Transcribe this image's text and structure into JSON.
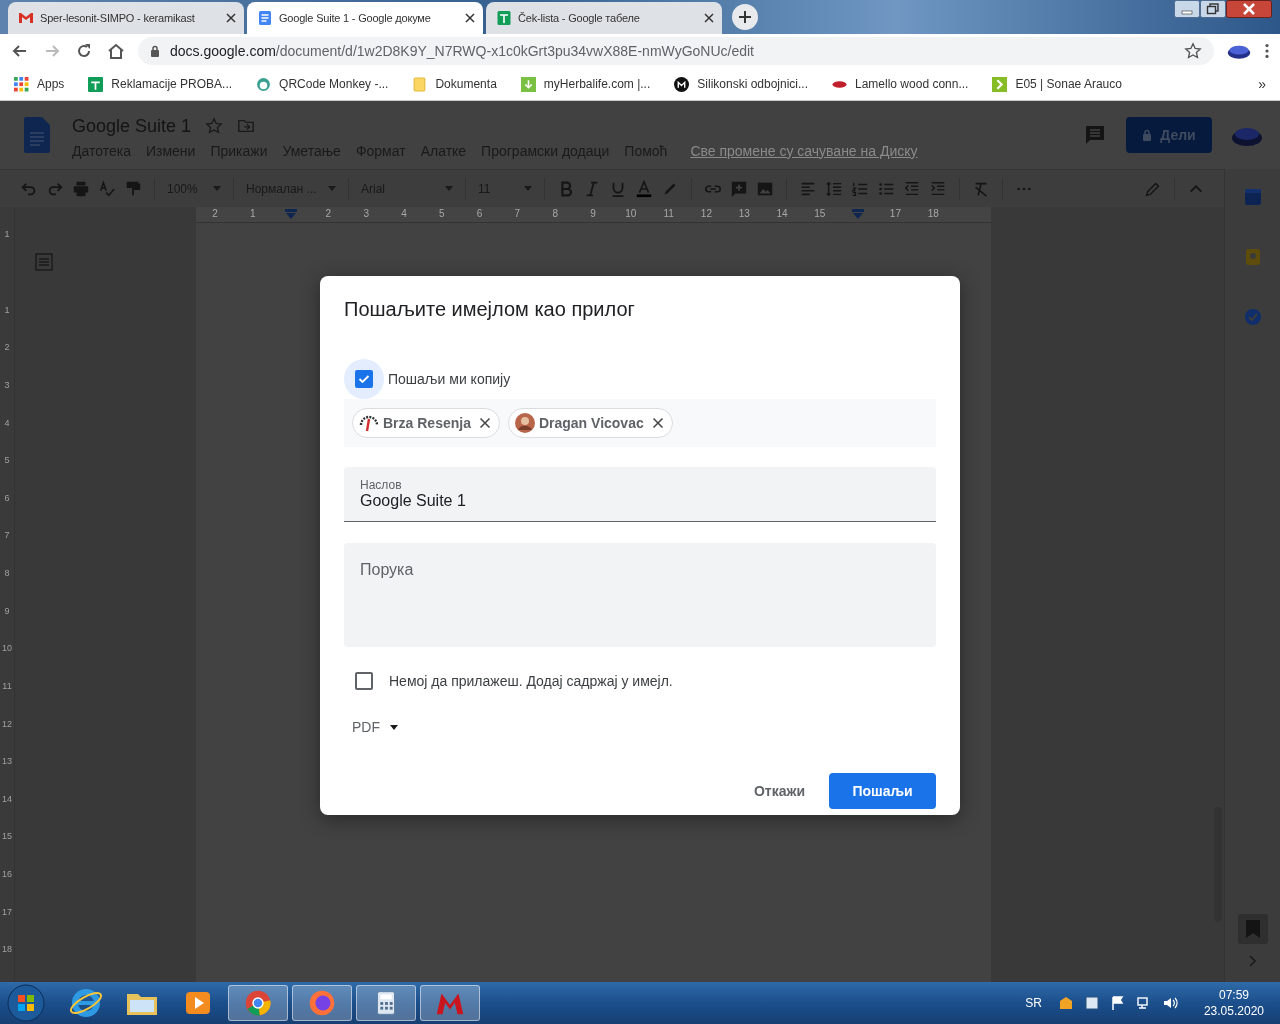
{
  "browser": {
    "tabs": [
      {
        "title": "Sper-lesonit-SIMPO - keramikast",
        "kind": "gmail",
        "selected": false
      },
      {
        "title": "Google Suite 1 - Google докуме",
        "kind": "docs",
        "selected": true
      },
      {
        "title": "Ček-lista - Google табеле",
        "kind": "sheets",
        "selected": false
      }
    ],
    "address": {
      "host": "docs.google.com",
      "path": "/document/d/1w2D8K9Y_N7RWQ-x1c0kGrt3pu34vwX88E-nmWyGoNUc/edit"
    },
    "bookmarks": [
      {
        "label": "Apps",
        "kind": "grid"
      },
      {
        "label": "Reklamacije PROBA...",
        "kind": "sheets"
      },
      {
        "label": "QRCode Monkey -...",
        "kind": "monkey"
      },
      {
        "label": "Dokumenta",
        "kind": "folder"
      },
      {
        "label": "myHerbalife.com |...",
        "kind": "download"
      },
      {
        "label": "Silikonski odbojnici...",
        "kind": "disc"
      },
      {
        "label": "Lamello wood conn...",
        "kind": "lips"
      },
      {
        "label": "E05 | Sonae Arauco",
        "kind": "chevron"
      }
    ],
    "bookmarks_more": "»"
  },
  "document": {
    "title": "Google Suite 1",
    "menu": [
      "Датотека",
      "Измени",
      "Прикажи",
      "Уметање",
      "Формат",
      "Алатке",
      "Програмски додаци",
      "Помоћ"
    ],
    "save_status": "Све промене су сачуване на Диску",
    "share_button": "Дели",
    "toolbar": {
      "zoom": "100%",
      "style": "Нормалан ...",
      "font": "Arial",
      "size": "11"
    },
    "ruler": [
      {
        "label": "2"
      },
      {
        "label": "1"
      },
      {
        "kind": "marker"
      },
      {
        "label": "2"
      },
      {
        "label": "3"
      },
      {
        "label": "4"
      },
      {
        "label": "5"
      },
      {
        "label": "6"
      },
      {
        "label": "7"
      },
      {
        "label": "8"
      },
      {
        "label": "9"
      },
      {
        "label": "10"
      },
      {
        "label": "11"
      },
      {
        "label": "12"
      },
      {
        "label": "13"
      },
      {
        "label": "14"
      },
      {
        "label": "15"
      },
      {
        "kind": "marker"
      },
      {
        "label": "17"
      },
      {
        "label": "18"
      }
    ],
    "side_ruler": [
      "1",
      "1",
      "2",
      "3",
      "4",
      "5",
      "6",
      "7",
      "8",
      "9",
      "10",
      "11",
      "12",
      "13",
      "14",
      "15",
      "16",
      "17",
      "18"
    ]
  },
  "dialog": {
    "title": "Пошаљите имејлом као прилог",
    "send_copy": {
      "label": "Пошаљи ми копију",
      "checked": true
    },
    "recipients": [
      {
        "name": "Brza Resenja",
        "kind": "gauge"
      },
      {
        "name": "Dragan Vicovac",
        "kind": "person"
      }
    ],
    "subject": {
      "label": "Наслов",
      "value": "Google Suite 1"
    },
    "message": {
      "placeholder": "Порука"
    },
    "no_attach": {
      "label": "Немој да прилажеш. Додај садржај у имејл.",
      "checked": false
    },
    "format": "PDF",
    "cancel_button": "Откажи",
    "send_button": "Пошаљи"
  },
  "taskbar": {
    "language": "SR",
    "time": "07:59",
    "date": "23.05.2020"
  }
}
